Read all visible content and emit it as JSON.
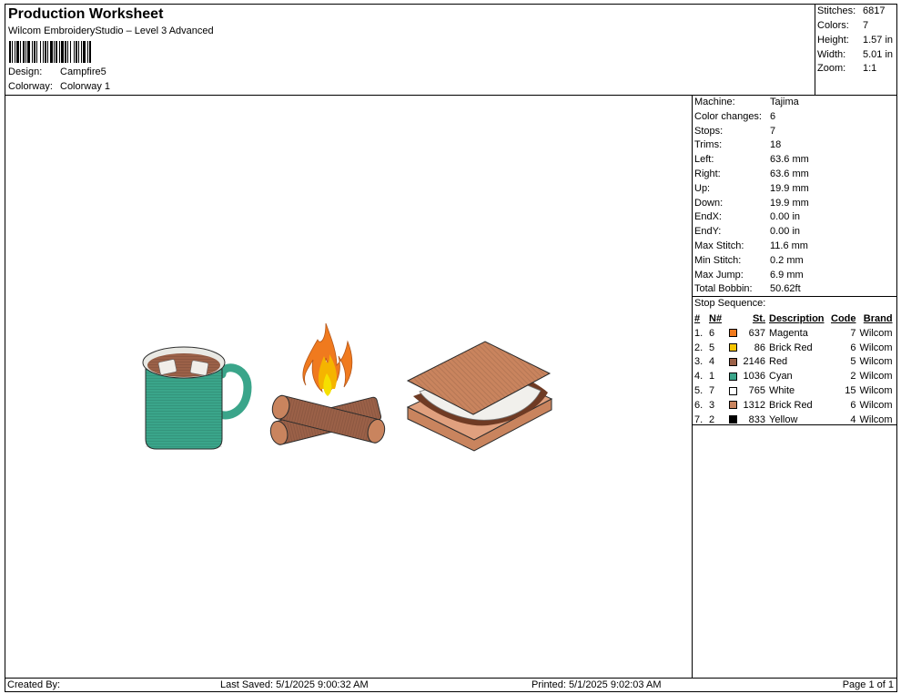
{
  "header": {
    "title": "Production Worksheet",
    "software": "Wilcom EmbroideryStudio – Level 3 Advanced",
    "design_label": "Design:",
    "design_value": "Campfire5",
    "colorway_label": "Colorway:",
    "colorway_value": "Colorway 1"
  },
  "summary": [
    {
      "label": "Stitches:",
      "value": "6817"
    },
    {
      "label": "Colors:",
      "value": "7"
    },
    {
      "label": "Height:",
      "value": "1.57 in"
    },
    {
      "label": "Width:",
      "value": "5.01 in"
    },
    {
      "label": "Zoom:",
      "value": "1:1"
    }
  ],
  "machine_info": [
    {
      "label": "Machine:",
      "value": "Tajima"
    },
    {
      "label": "Color changes:",
      "value": "6"
    },
    {
      "label": "Stops:",
      "value": "7"
    },
    {
      "label": "Trims:",
      "value": "18"
    },
    {
      "label": "Left:",
      "value": "63.6 mm"
    },
    {
      "label": "Right:",
      "value": "63.6 mm"
    },
    {
      "label": "Up:",
      "value": "19.9 mm"
    },
    {
      "label": "Down:",
      "value": "19.9 mm"
    },
    {
      "label": "EndX:",
      "value": "0.00 in"
    },
    {
      "label": "EndY:",
      "value": "0.00 in"
    },
    {
      "label": "Max Stitch:",
      "value": "11.6 mm"
    },
    {
      "label": "Min Stitch:",
      "value": "0.2 mm"
    },
    {
      "label": "Max Jump:",
      "value": "6.9 mm"
    },
    {
      "label": "Total Bobbin:",
      "value": "50.62ft"
    }
  ],
  "stop_sequence": {
    "title": "Stop Sequence:",
    "headers": {
      "num": "#",
      "n": "N#",
      "st": "St.",
      "desc": "Description",
      "code": "Code",
      "brand": "Brand"
    },
    "rows": [
      {
        "num": "1.",
        "n": "6",
        "color": "#f07a1e",
        "st": "637",
        "desc": "Magenta",
        "code": "7",
        "brand": "Wilcom"
      },
      {
        "num": "2.",
        "n": "5",
        "color": "#f5c400",
        "st": "86",
        "desc": "Brick Red",
        "code": "6",
        "brand": "Wilcom"
      },
      {
        "num": "3.",
        "n": "4",
        "color": "#9b6148",
        "st": "2146",
        "desc": "Red",
        "code": "5",
        "brand": "Wilcom"
      },
      {
        "num": "4.",
        "n": "1",
        "color": "#3aa58a",
        "st": "1036",
        "desc": "Cyan",
        "code": "2",
        "brand": "Wilcom"
      },
      {
        "num": "5.",
        "n": "7",
        "color": "#ffffff",
        "st": "765",
        "desc": "White",
        "code": "15",
        "brand": "Wilcom"
      },
      {
        "num": "6.",
        "n": "3",
        "color": "#c9845e",
        "st": "1312",
        "desc": "Brick Red",
        "code": "6",
        "brand": "Wilcom"
      },
      {
        "num": "7.",
        "n": "2",
        "color": "#000000",
        "st": "833",
        "desc": "Yellow",
        "code": "4",
        "brand": "Wilcom"
      }
    ]
  },
  "footer": {
    "created_by": "Created By:",
    "last_saved": "Last Saved: 5/1/2025 9:00:32 AM",
    "printed": "Printed: 5/1/2025 9:02:03 AM",
    "page": "Page 1 of 1"
  }
}
